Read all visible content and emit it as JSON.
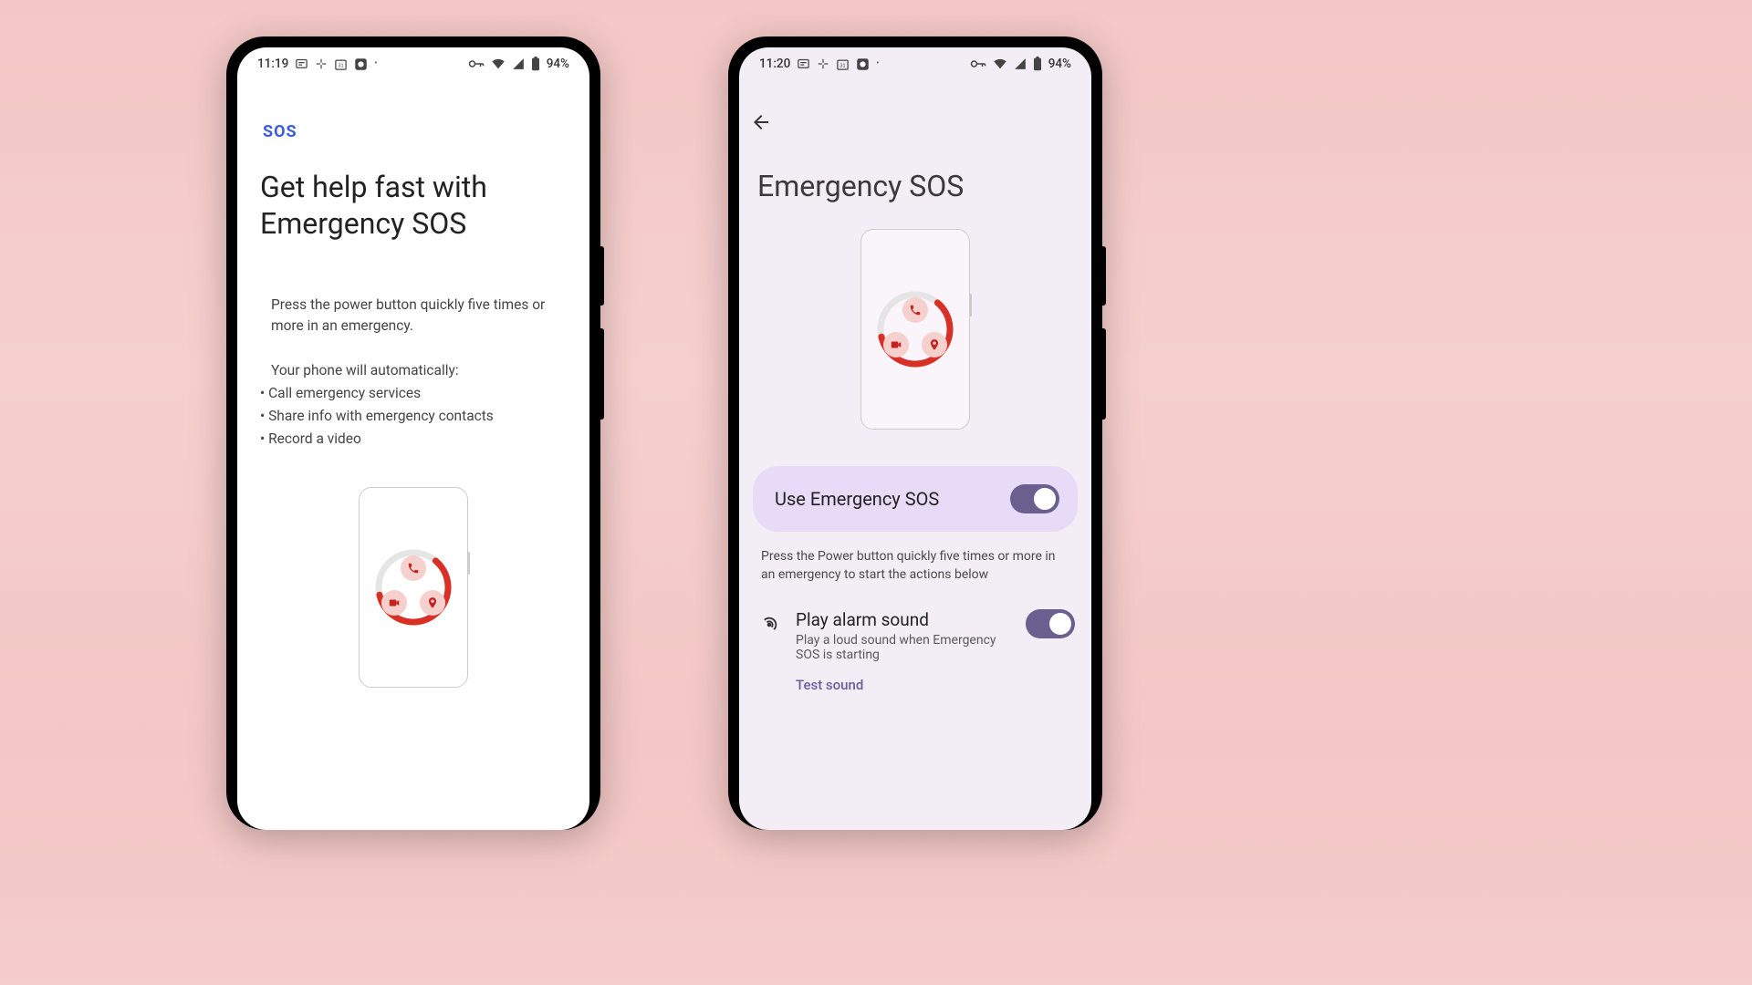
{
  "left": {
    "statusbar": {
      "time": "11:19",
      "battery": "94%"
    },
    "sos_label": "SOS",
    "headline": "Get help fast with Emergency SOS",
    "instruction": "Press the power button quickly five times or more in an emergency.",
    "auto_intro": "Your phone will automatically:",
    "bullets": {
      "b1": "• Call emergency services",
      "b2": "• Share info with emergency contacts",
      "b3": "• Record a video"
    }
  },
  "right": {
    "statusbar": {
      "time": "11:20",
      "battery": "94%"
    },
    "page_title": "Emergency SOS",
    "use_sos_label": "Use Emergency SOS",
    "help_text": "Press the Power button quickly five times or more in an emergency to start the actions below",
    "alarm": {
      "title": "Play alarm sound",
      "subtitle": "Play a loud sound when Emergency SOS is starting",
      "link": "Test sound"
    }
  }
}
